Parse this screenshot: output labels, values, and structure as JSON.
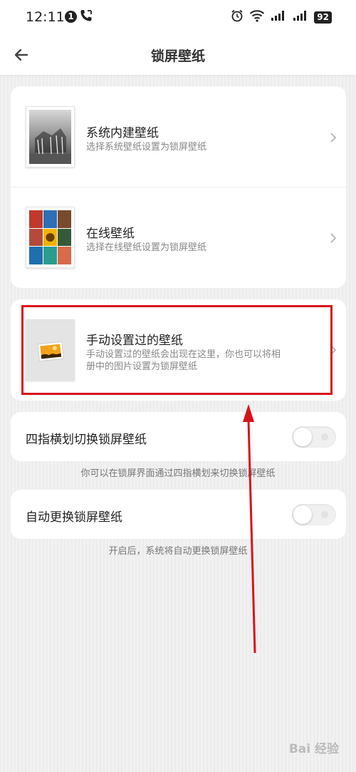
{
  "status_bar": {
    "time": "12:11",
    "notification_count": "1",
    "battery": "92"
  },
  "header": {
    "title": "锁屏壁纸"
  },
  "wallpaper_sources": [
    {
      "title": "系统内建壁纸",
      "subtitle": "选择系统壁纸设置为锁屏壁纸",
      "icon": "zebra-photo-icon"
    },
    {
      "title": "在线壁纸",
      "subtitle": "选择在线壁纸设置为锁屏壁纸",
      "icon": "photo-grid-icon"
    }
  ],
  "manual": {
    "title": "手动设置过的壁纸",
    "subtitle_line1": "手动设置过的壁纸会出现在这里，你也可以将相",
    "subtitle_line2": "册中的图片设置为锁屏壁纸",
    "icon": "picture-icon"
  },
  "toggles": [
    {
      "label": "四指横划切换锁屏壁纸",
      "hint": "你可以在锁屏界面通过四指横划来切换锁屏壁纸",
      "enabled": false
    },
    {
      "label": "自动更换锁屏壁纸",
      "hint": "开启后，系统将自动更换锁屏壁纸",
      "enabled": false
    }
  ],
  "watermark": "Bai 经验",
  "colors": {
    "annotation_red": "#d8131b",
    "background": "#f1f1f1",
    "card": "#ffffff"
  }
}
